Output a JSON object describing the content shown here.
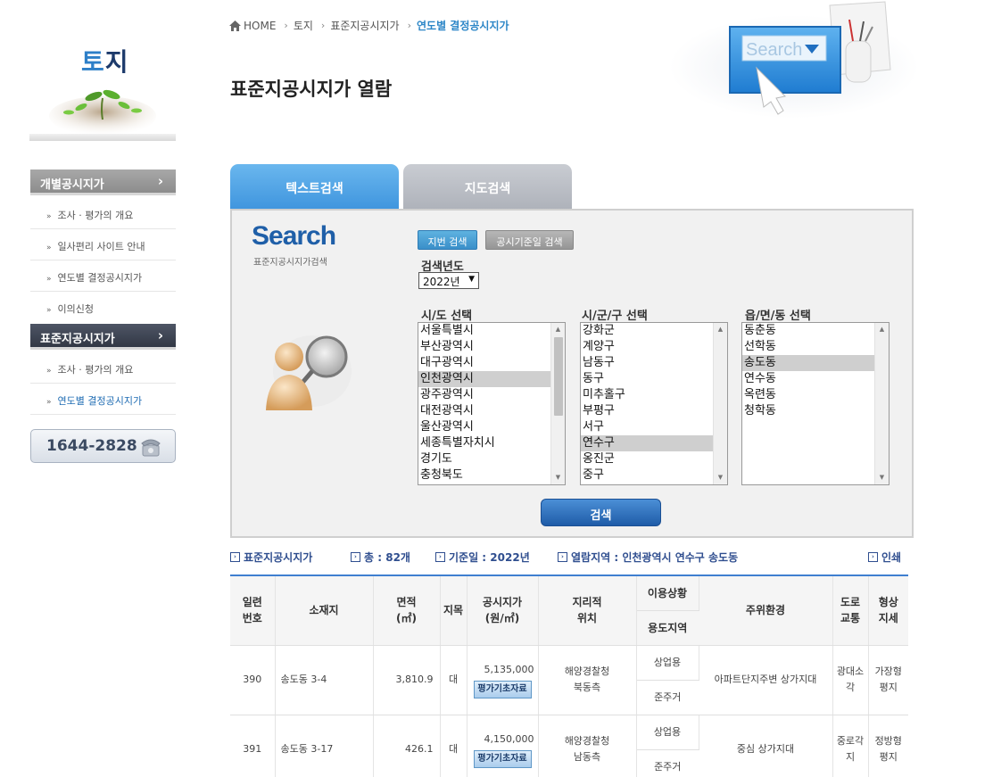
{
  "sidebar": {
    "title_part1": "토",
    "title_part2": "지",
    "section1": {
      "label": "개별공시지가",
      "items": [
        "조사 · 평가의 개요",
        "일사편리 사이트 안내",
        "연도별 결정공시지가",
        "이의신청"
      ]
    },
    "section2": {
      "label": "표준지공시지가",
      "items": [
        "조사 · 평가의 개요",
        "연도별 결정공시지가"
      ]
    },
    "phone": "1644-2828"
  },
  "breadcrumb": {
    "home": "HOME",
    "items": [
      "토지",
      "표준지공시지가",
      "연도별 결정공시지가"
    ]
  },
  "page_title": "표준지공시지가 열람",
  "hero_search_text": "Search",
  "tabs": {
    "text_search": "텍스트검색",
    "map_search": "지도검색"
  },
  "panel": {
    "logo": "Search",
    "logo_sub": "표준지공시지가검색",
    "btn_lot": "지번 검색",
    "btn_date": "공시기준일 검색",
    "year_label": "검색년도",
    "year_value": "2022년",
    "sido_label": "시/도 선택",
    "sigungu_label": "시/군/구 선택",
    "dong_label": "읍/면/동 선택",
    "sido_options": [
      "서울특별시",
      "부산광역시",
      "대구광역시",
      "인천광역시",
      "광주광역시",
      "대전광역시",
      "울산광역시",
      "세종특별자치시",
      "경기도",
      "충청북도"
    ],
    "sigungu_options": [
      "강화군",
      "계양구",
      "남동구",
      "동구",
      "미추홀구",
      "부평구",
      "서구",
      "연수구",
      "옹진군",
      "중구"
    ],
    "dong_options": [
      "동춘동",
      "선학동",
      "송도동",
      "연수동",
      "옥련동",
      "청학동"
    ],
    "search_button": "검색"
  },
  "info": {
    "category": "표준지공시지가",
    "total_label": "총 :",
    "total_value": "82개",
    "date_label": "기준일 :",
    "date_value": "2022년",
    "region_label": "열람지역 :",
    "region_value": "인천광역시 연수구 송도동",
    "print": "인쇄"
  },
  "table": {
    "headers": {
      "serial": "일련\n번호",
      "address": "소재지",
      "area": "면적\n(㎡)",
      "category": "지목",
      "price": "공시지가\n(원/㎡)",
      "location": "지리적\n위치",
      "usage_group": "이용상황",
      "zoning": "용도지역",
      "environment": "주위환경",
      "road": "도로\n교통",
      "shape": "형상\n지세"
    },
    "eval_button": "평가기초자료",
    "rows": [
      {
        "serial": "390",
        "address": "송도동 3-4",
        "area": "3,810.9",
        "category": "대",
        "price": "5,135,000",
        "location": "해양경찰청\n북동측",
        "usage": "상업용",
        "zoning": "준주거",
        "environment": "아파트단지주변 상가지대",
        "road": "광대소각",
        "shape": "가장형\n평지"
      },
      {
        "serial": "391",
        "address": "송도동 3-17",
        "area": "426.1",
        "category": "대",
        "price": "4,150,000",
        "location": "해양경찰청\n남동측",
        "usage": "상업용",
        "zoning": "준주거",
        "environment": "중심 상가지대",
        "road": "중로각\n지",
        "shape": "정방형\n평지"
      }
    ]
  },
  "colors": {
    "accent": "#3f95de",
    "nav_dark": "#323845",
    "link": "#2f4e8f"
  }
}
